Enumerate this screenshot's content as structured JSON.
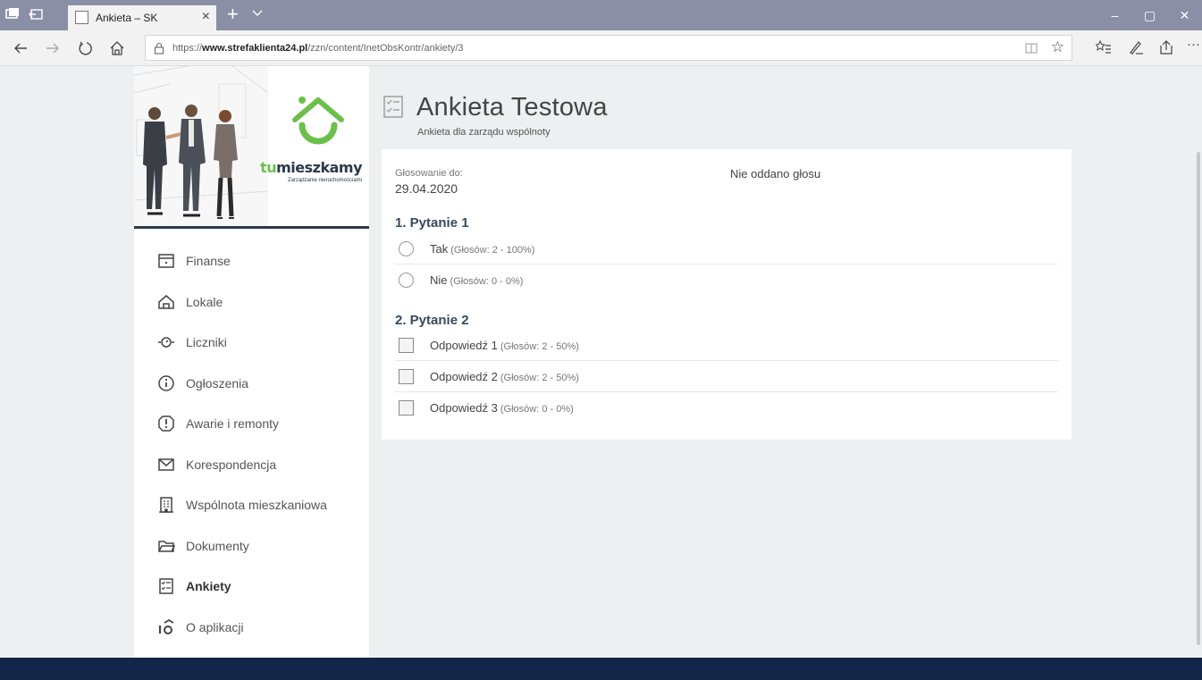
{
  "browser": {
    "tab_title": "Ankieta – SK",
    "tab_close": "×",
    "new_tab": "+",
    "url_prefix": "https://",
    "url_domain": "www.strefaklienta24.pl",
    "url_path": "/zzn/content/InetObsKontr/ankiety/3",
    "win_minimize": "–",
    "win_maximize": "▢",
    "win_close": "✕",
    "more": "···",
    "star": "☆"
  },
  "brand": {
    "name_accent": "tu",
    "name_rest": "mieszkamy",
    "tagline": "Zarządzanie nieruchomościami",
    "accent_color": "#6cc04a",
    "dark_color": "#2a3a4a"
  },
  "menu": [
    {
      "label": "Finanse",
      "icon": "finance-icon"
    },
    {
      "label": "Lokale",
      "icon": "home-icon"
    },
    {
      "label": "Liczniki",
      "icon": "meter-icon"
    },
    {
      "label": "Ogłoszenia",
      "icon": "info-icon"
    },
    {
      "label": "Awarie i remonty",
      "icon": "alert-icon"
    },
    {
      "label": "Korespondencja",
      "icon": "mail-icon"
    },
    {
      "label": "Wspólnota mieszkaniowa",
      "icon": "building-icon"
    },
    {
      "label": "Dokumenty",
      "icon": "folder-icon"
    },
    {
      "label": "Ankiety",
      "icon": "survey-icon",
      "active": true
    },
    {
      "label": "O aplikacji",
      "icon": "about-icon"
    }
  ],
  "page": {
    "title": "Ankieta Testowa",
    "subtitle": "Ankieta dla zarządu wspólnoty"
  },
  "survey": {
    "vote_label": "Głosowanie do:",
    "vote_date": "29.04.2020",
    "status": "Nie oddano głosu",
    "questions": [
      {
        "title": "1. Pytanie 1",
        "type": "radio",
        "options": [
          {
            "label": "Tak",
            "stats": "(Głosów: 2 - 100%)"
          },
          {
            "label": "Nie",
            "stats": "(Głosów: 0 - 0%)"
          }
        ]
      },
      {
        "title": "2. Pytanie 2",
        "type": "checkbox",
        "options": [
          {
            "label": "Odpowiedź 1",
            "stats": "(Głosów: 2 - 50%)"
          },
          {
            "label": "Odpowiedź 2",
            "stats": "(Głosów: 2 - 50%)"
          },
          {
            "label": "Odpowiedź 3",
            "stats": "(Głosów: 0 - 0%)"
          }
        ]
      }
    ]
  },
  "colors": {
    "footer": "#14254a",
    "tabbar": "#8a8fa5"
  }
}
